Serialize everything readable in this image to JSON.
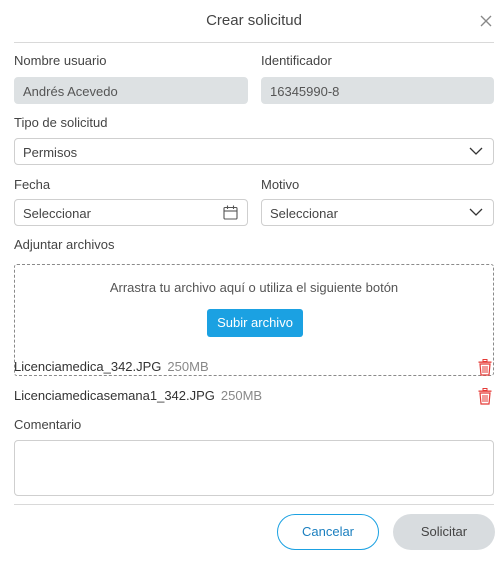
{
  "header": {
    "title": "Crear solicitud"
  },
  "user": {
    "name_label": "Nombre usuario",
    "name_value": "Andrés Acevedo",
    "id_label": "Identificador",
    "id_value": "16345990-8"
  },
  "request_type": {
    "label": "Tipo de solicitud",
    "value": "Permisos"
  },
  "date": {
    "label": "Fecha",
    "placeholder": "Seleccionar"
  },
  "reason": {
    "label": "Motivo",
    "placeholder": "Seleccionar"
  },
  "attachments": {
    "label": "Adjuntar archivos",
    "drop_text": "Arrastra tu archivo aquí o utiliza el siguiente botón",
    "upload_label": "Subir archivo",
    "files": [
      {
        "name": "Licenciamedica_342.JPG",
        "size": "250MB"
      },
      {
        "name": "Licenciamedicasemana1_342.JPG",
        "size": "250MB"
      }
    ]
  },
  "comment": {
    "label": "Comentario",
    "value": ""
  },
  "footer": {
    "cancel_label": "Cancelar",
    "submit_label": "Solicitar"
  },
  "colors": {
    "accent": "#1ba1e2",
    "danger": "#e53935",
    "disabled_field": "#dde1e3",
    "disabled_button": "#d8dcdf"
  },
  "icons": {
    "close": "close-icon",
    "chevron": "chevron-down-icon",
    "calendar": "calendar-icon",
    "delete": "trash-icon"
  }
}
